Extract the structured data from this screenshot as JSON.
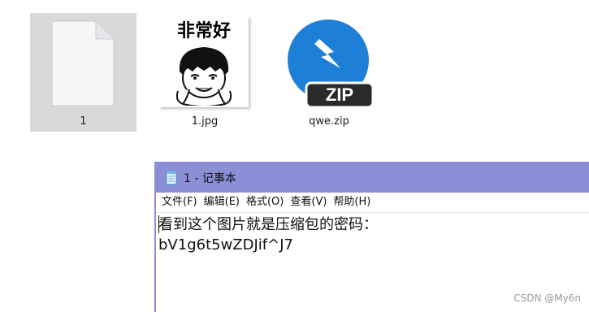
{
  "desktop": {
    "files": [
      {
        "name": "1",
        "icon": "blank-document-icon",
        "selected": true
      },
      {
        "name": "1.jpg",
        "icon": "image-thumbnail",
        "image_caption": "非常好"
      },
      {
        "name": "qwe.zip",
        "icon": "zip-archive-icon",
        "icon_badge": "ZIP"
      }
    ]
  },
  "notepad": {
    "title": "1 - 记事本",
    "menu": [
      "文件(F)",
      "编辑(E)",
      "格式(O)",
      "查看(V)",
      "帮助(H)"
    ],
    "content": [
      "看到这个图片就是压缩包的密码：",
      "bV1g6t5wZDJif^J7"
    ],
    "titlebar_color": "#8b8fd6"
  },
  "watermark": "CSDN @My6n",
  "colors": {
    "zip_blue": "#1e7fd8",
    "selection": "#d9d9d9"
  }
}
